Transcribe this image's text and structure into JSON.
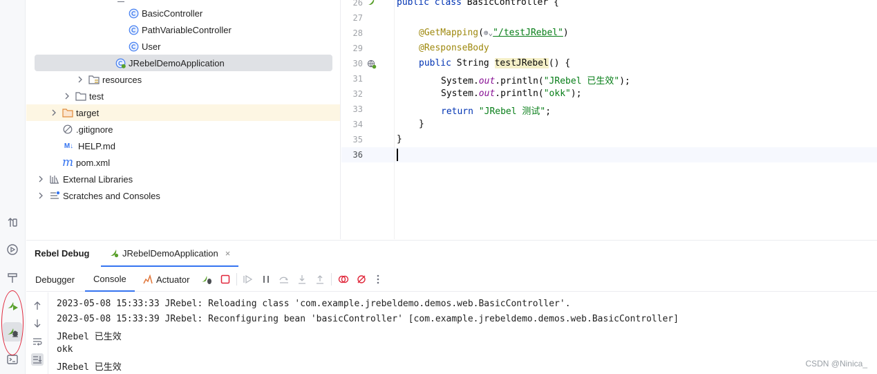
{
  "project_tree": {
    "items": [
      {
        "label": "BasicController",
        "type": "class"
      },
      {
        "label": "PathVariableController",
        "type": "class"
      },
      {
        "label": "User",
        "type": "class"
      },
      {
        "label": "JRebelDemoApplication",
        "type": "spring-app-class"
      },
      {
        "label": "resources",
        "type": "folder"
      },
      {
        "label": "test",
        "type": "folder"
      },
      {
        "label": "target",
        "type": "folder-excluded"
      },
      {
        "label": ".gitignore",
        "type": "ignore-file"
      },
      {
        "label": "HELP.md",
        "type": "markdown"
      },
      {
        "label": "pom.xml",
        "type": "maven"
      },
      {
        "label": "External Libraries",
        "type": "libraries"
      },
      {
        "label": "Scratches and Consoles",
        "type": "scratches"
      }
    ]
  },
  "editor": {
    "line_numbers": [
      "26",
      "27",
      "28",
      "29",
      "30",
      "31",
      "32",
      "33",
      "34",
      "35",
      "36"
    ],
    "line26": {
      "kw": "public class",
      "rest": " BasicController {"
    },
    "line28": {
      "ann": "@GetMapping",
      "open": "(",
      "globe": "⊕⌄",
      "path": "\"/testJRebel\"",
      "close": ")"
    },
    "line29": {
      "ann": "@ResponseBody"
    },
    "line30": {
      "kw": "public",
      "type": " String ",
      "method": "testJRebel",
      "rest": "() {"
    },
    "line31": {
      "pre": "System.",
      "field": "out",
      "mid": ".println(",
      "str": "\"JRebel 已生效\"",
      "end": ");"
    },
    "line32": {
      "pre": "System.",
      "field": "out",
      "mid": ".println(",
      "str": "\"okk\"",
      "end": ");"
    },
    "line33": {
      "kw": "return",
      "str": " \"JRebel 测试\"",
      "end": ";"
    },
    "line34": "}",
    "line35": "}"
  },
  "bottom_panel": {
    "title": "Rebel Debug",
    "run_tab": "JRebelDemoApplication",
    "close_symbol": "×",
    "tabs": [
      "Debugger",
      "Console",
      "Actuator"
    ],
    "selected_tab": "Console",
    "console_lines": [
      "2023-05-08 15:33:33 JRebel: Reloading class 'com.example.jrebeldemo.demos.web.BasicController'.",
      "2023-05-08 15:33:39 JRebel: Reconfiguring bean 'basicController' [com.example.jrebeldemo.demos.web.BasicController]",
      "JRebel 已生效",
      "okk",
      "JRebel 已生效"
    ]
  },
  "watermark": "CSDN @Ninica_",
  "colors": {
    "accent": "#3574f0",
    "selection": "#dfe1e5",
    "target_row": "#fdf6e3",
    "annotation_ring": "#e0263a",
    "jrebel_green": "#5aa02c"
  }
}
